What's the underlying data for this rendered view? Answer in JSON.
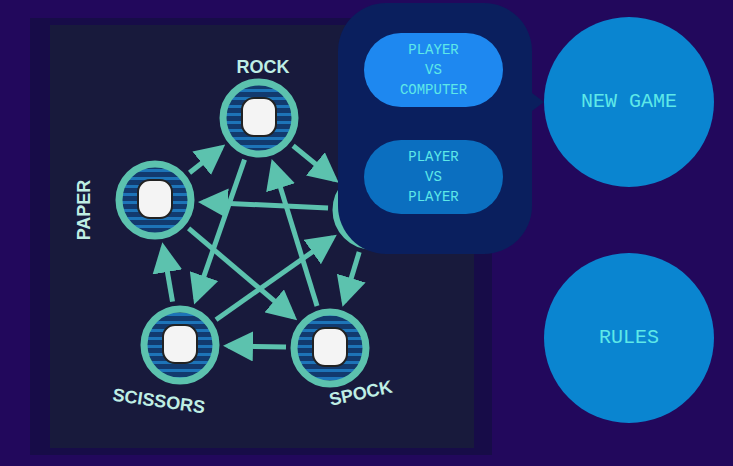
{
  "diagram": {
    "nodes": [
      {
        "label": "ROCK"
      },
      {
        "label": "PAPER"
      },
      {
        "label": "SCISSORS"
      },
      {
        "label": "SPOCK"
      }
    ]
  },
  "new_game_menu": {
    "options": [
      {
        "label": "PLAYER\nVS\nCOMPUTER",
        "selected": true
      },
      {
        "label": "PLAYER\nVS\nPLAYER",
        "selected": false
      }
    ]
  },
  "buttons": [
    {
      "label": "NEW GAME",
      "expanded": true
    },
    {
      "label": "RULES",
      "expanded": false
    }
  ]
}
